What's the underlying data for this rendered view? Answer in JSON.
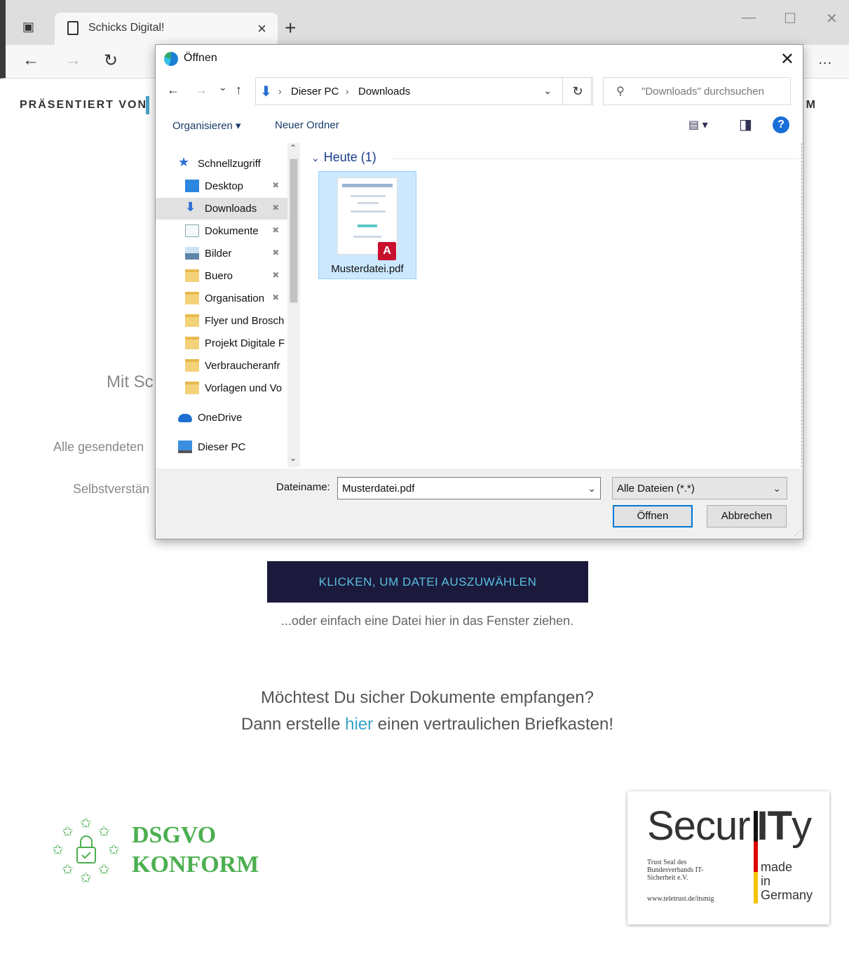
{
  "browser": {
    "tab_title": "Schicks Digital!",
    "tab_close": "×",
    "new_tab": "+",
    "window_min": "—",
    "window_max": "☐",
    "window_close": "✕",
    "back": "←",
    "forward": "→",
    "reload": "↻",
    "more": "..."
  },
  "page": {
    "presented_by": "PRÄSENTIERT VON",
    "nav_fragment": "M",
    "fragment_heading": "Mit Sc",
    "fragment_line1": "Alle gesendeten",
    "fragment_line2": "Selbstverstän",
    "upload_button": "KLICKEN, UM DATEI AUSZUWÄHLEN",
    "drop_hint": "...oder einfach eine Datei hier in das Fenster ziehen.",
    "cta_line1": "Möchtest Du sicher Dokumente empfangen?",
    "cta_line2_before": "Dann erstelle ",
    "cta_line2_link": "hier",
    "cta_line2_after": " einen vertraulichen Briefkasten!",
    "dsgvo_line1": "DSGVO",
    "dsgvo_line2": "KONFORM",
    "seal_title_a": "Secur",
    "seal_title_b": "IT",
    "seal_title_c": "y",
    "seal_small": "Trust Seal des Bundesverbands IT-Sicherheit e.V.",
    "seal_url": "www.teletrust.de/itsmig",
    "seal_made_1": "made",
    "seal_made_2": "in",
    "seal_made_3": "Germany"
  },
  "dialog": {
    "title": "Öffnen",
    "close": "✕",
    "nav_back": "←",
    "nav_forward": "→",
    "nav_recent": "⌄",
    "nav_up": "↑",
    "breadcrumb": [
      "Dieser PC",
      "Downloads"
    ],
    "crumb_sep": "›",
    "address_chevron": "⌄",
    "refresh": "↻",
    "search_icon": "⚲",
    "search_placeholder": "\"Downloads\" durchsuchen",
    "organize": "Organisieren ▾",
    "new_folder": "Neuer Ordner",
    "view_glyph": "▤ ▾",
    "pane_glyph": "◨",
    "help": "?",
    "nav_items": [
      {
        "label": "Schnellzugriff",
        "icon": "star",
        "pinned": false
      },
      {
        "label": "Desktop",
        "icon": "desktop",
        "pinned": true
      },
      {
        "label": "Downloads",
        "icon": "download",
        "pinned": true,
        "selected": true
      },
      {
        "label": "Dokumente",
        "icon": "document",
        "pinned": true
      },
      {
        "label": "Bilder",
        "icon": "pictures",
        "pinned": true
      },
      {
        "label": "Buero",
        "icon": "user-folder",
        "pinned": true
      },
      {
        "label": "Organisation",
        "icon": "user-folder",
        "pinned": true
      },
      {
        "label": "Flyer und Brosch",
        "icon": "folder",
        "pinned": false
      },
      {
        "label": "Projekt Digitale F",
        "icon": "folder",
        "pinned": false
      },
      {
        "label": "Verbraucheranfr",
        "icon": "folder",
        "pinned": false
      },
      {
        "label": "Vorlagen und Vo",
        "icon": "folder",
        "pinned": false
      },
      {
        "label": "OneDrive",
        "icon": "cloud",
        "pinned": false
      },
      {
        "label": "Dieser PC",
        "icon": "computer",
        "pinned": false
      }
    ],
    "pin_glyph": "📌",
    "group_header": "Heute (1)",
    "group_chevron": "⌄",
    "file_name": "Musterdatei.pdf",
    "pdf_glyph": "A",
    "filename_label": "Dateiname:",
    "filename_value": "Musterdatei.pdf",
    "filter_value": "Alle Dateien (*.*)",
    "open_button": "Öffnen",
    "cancel_button": "Abbrechen"
  },
  "colors": {
    "upload_bg": "#1b1a3c",
    "upload_text": "#5ac0e0",
    "link": "#3aa3c8",
    "dsgvo": "#4caf50",
    "selection": "#cce8ff",
    "pdf_red": "#c8102e",
    "accent": "#0078d7"
  }
}
